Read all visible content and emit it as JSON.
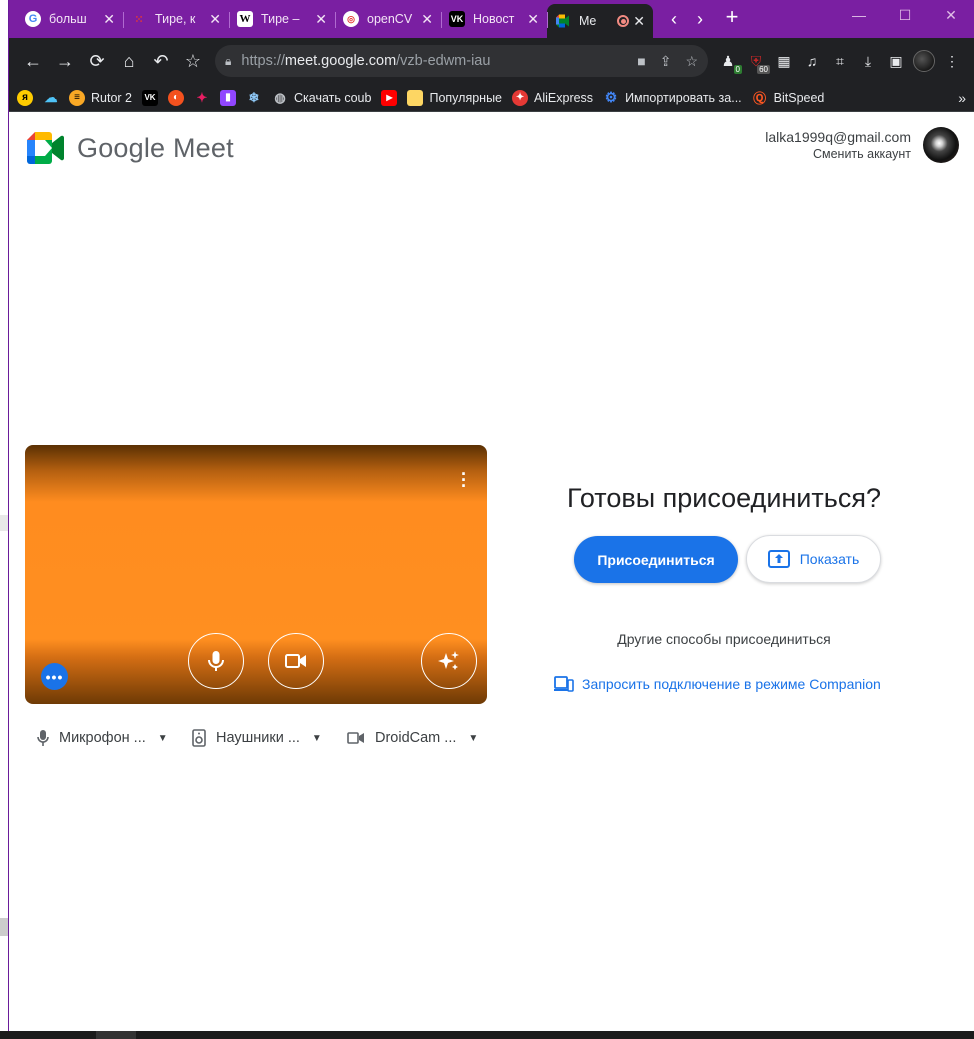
{
  "tabs": [
    {
      "title": "больш",
      "favicon": "google-icon"
    },
    {
      "title": "Тире, к",
      "favicon": "dots-icon"
    },
    {
      "title": "Тире –",
      "favicon": "wikipedia-icon"
    },
    {
      "title": "openCV",
      "favicon": "opencv-icon"
    },
    {
      "title": "Новост",
      "favicon": "vk-icon"
    },
    {
      "title": "Me",
      "favicon": "google-meet-icon",
      "active": true
    }
  ],
  "tab_controls": {
    "back": "‹",
    "forward": "›",
    "new": "+"
  },
  "window_controls": {
    "minimize": "—",
    "maximize": "☐",
    "close": "✕"
  },
  "address": {
    "scheme": "https://",
    "host": "meet.google.com",
    "path": "/vzb-edwm-iau"
  },
  "extensions": {
    "badge1": "0",
    "badge2": "60"
  },
  "bookmarks": [
    {
      "label": "",
      "icon": "yandex-icon"
    },
    {
      "label": "",
      "icon": "weather-icon"
    },
    {
      "label": "Rutor 2",
      "icon": "rutor-icon"
    },
    {
      "label": "",
      "icon": "vk-icon"
    },
    {
      "label": "",
      "icon": "aim-icon"
    },
    {
      "label": "",
      "icon": "star-icon"
    },
    {
      "label": "",
      "icon": "twitch-icon"
    },
    {
      "label": "",
      "icon": "snowflake-icon"
    },
    {
      "label": "Скачать coub",
      "icon": "globe-icon"
    },
    {
      "label": "",
      "icon": "youtube-icon"
    },
    {
      "label": "Популярные",
      "icon": "folder-icon"
    },
    {
      "label": "AliExpress",
      "icon": "aliexpress-icon"
    },
    {
      "label": "Импортировать за...",
      "icon": "gear-icon"
    },
    {
      "label": "BitSpeed",
      "icon": "bitspeed-icon"
    }
  ],
  "meet": {
    "brand": "Google Meet",
    "account_email": "lalka1999q@gmail.com",
    "switch_account": "Сменить аккаунт",
    "ready_title": "Готовы присоединиться?",
    "join_label": "Присоединиться",
    "present_label": "Показать",
    "other_ways": "Другие способы присоединиться",
    "companion_label": "Запросить подключение в режиме Companion",
    "devices": [
      {
        "label": "Микрофон ...",
        "icon": "mic-icon"
      },
      {
        "label": "Наушники ...",
        "icon": "speaker-icon"
      },
      {
        "label": "DroidCam ...",
        "icon": "camera-icon"
      }
    ]
  },
  "colors": {
    "tabstrip": "#7a1fa2",
    "chrome_dark": "#202124",
    "accent": "#1a73e8",
    "preview_orange": "#ff8f20"
  }
}
